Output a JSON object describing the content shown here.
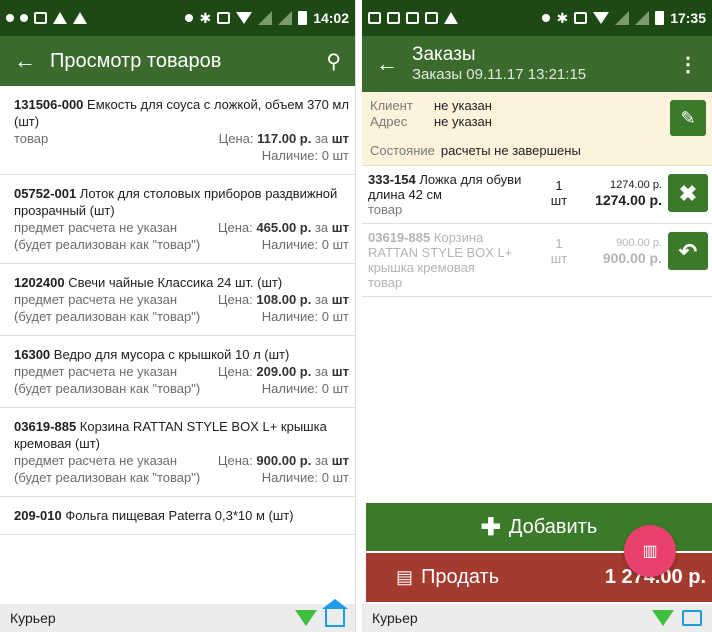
{
  "left": {
    "status": {
      "time": "14:02"
    },
    "title": "Просмотр товаров",
    "products": [
      {
        "code": "131506-000",
        "name": "Емкость для соуса с ложкой, объем 370 мл (шт)",
        "type": "товар",
        "price": "117.00 р.",
        "unit": "шт",
        "stock": "0 шт"
      },
      {
        "code": "05752-001",
        "name": "Лоток для столовых приборов раздвижной прозрачный (шт)",
        "type": "предмет расчета не указан (будет реализован как \"товар\")",
        "price": "465.00 р.",
        "unit": "шт",
        "stock": "0 шт"
      },
      {
        "code": "1202400",
        "name": "Свечи чайные Классика 24 шт. (шт)",
        "type": "предмет расчета не указан (будет реализован как \"товар\")",
        "price": "108.00 р.",
        "unit": "шт",
        "stock": "0 шт"
      },
      {
        "code": "16300",
        "name": "Ведро для мусора с крышкой 10 л (шт)",
        "type": "предмет расчета не указан (будет реализован как \"товар\")",
        "price": "209.00 р.",
        "unit": "шт",
        "stock": "0 шт"
      },
      {
        "code": "03619-885",
        "name": "Корзина RATTAN STYLE BOX L+ крышка кремовая (шт)",
        "type": "предмет расчета не указан (будет реализован как \"товар\")",
        "price": "900.00 р.",
        "unit": "шт",
        "stock": "0 шт"
      },
      {
        "code": "209-010",
        "name": "Фольга пищевая Paterra 0,3*10 м (шт)",
        "type": "",
        "price": "",
        "unit": "",
        "stock": ""
      }
    ],
    "labels": {
      "price_prefix": "Цена:",
      "per": "за",
      "stock_prefix": "Наличие:"
    },
    "footer": "Курьер"
  },
  "right": {
    "status": {
      "time": "17:35"
    },
    "title": "Заказы",
    "subtitle": "Заказы 09.11.17 13:21:15",
    "client": {
      "client_label": "Клиент",
      "client_value": "не указан",
      "address_label": "Адрес",
      "address_value": "не указан",
      "state_label": "Состояние",
      "state_value": "расчеты не завершены"
    },
    "items": [
      {
        "code": "333-154",
        "name": "Ложка для обуви длина 42 см",
        "type": "товар",
        "qty": "1",
        "unit": "шт",
        "price": "1274.00 р.",
        "total": "1274.00 р."
      },
      {
        "code": "03619-885",
        "name": "Корзина RATTAN STYLE BOX L+ крышка кремовая",
        "type": "товар",
        "qty": "1",
        "unit": "шт",
        "price": "900.00 р.",
        "total": "900.00 р."
      }
    ],
    "add_label": "Добавить",
    "sell_label": "Продать",
    "sell_total": "1 274.00 р.",
    "footer": "Курьер"
  },
  "colors": {
    "appbar": "#3b6b2c",
    "statusbar": "#1d4a14",
    "button_green": "#3b7a2a",
    "sell_red": "#a53a2e",
    "fab": "#e8416b"
  }
}
